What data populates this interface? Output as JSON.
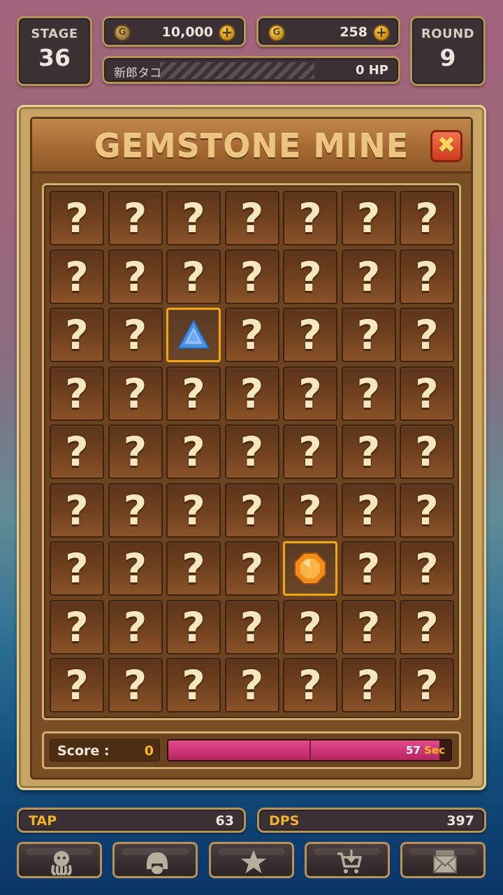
{
  "hud": {
    "stage_label": "STAGE",
    "stage_value": "36",
    "gold_amount": "10,000",
    "gem_amount": "258",
    "round_label": "ROUND",
    "round_value": "9",
    "enemy_name": "新郎タコ",
    "enemy_hp": "0 HP"
  },
  "mine": {
    "title": "GEMSTONE MINE",
    "close_icon": "close-icon",
    "unknown_glyph": "?",
    "rows": 9,
    "cols": 7,
    "revealed": [
      {
        "row": 3,
        "col": 3,
        "gem": "blue-triangle-gem-icon",
        "color": "#4a8fe0"
      },
      {
        "row": 7,
        "col": 5,
        "gem": "orange-octagon-gem-icon",
        "color": "#f28c1a"
      }
    ],
    "score_label": "Score :",
    "score_value": "0",
    "timer_value": "57",
    "timer_unit": "Sec",
    "timer_fraction": 0.96
  },
  "bottom": {
    "tap_label": "TAP",
    "tap_value": "63",
    "dps_label": "DPS",
    "dps_value": "397",
    "nav": [
      "character-icon",
      "helmet-icon",
      "star-icon",
      "shop-cart-icon",
      "mail-icon"
    ]
  },
  "colors": {
    "accent_gold": "#f1b12a",
    "frame_gold": "#b7935a",
    "timer_pink": "#d23a7c"
  }
}
